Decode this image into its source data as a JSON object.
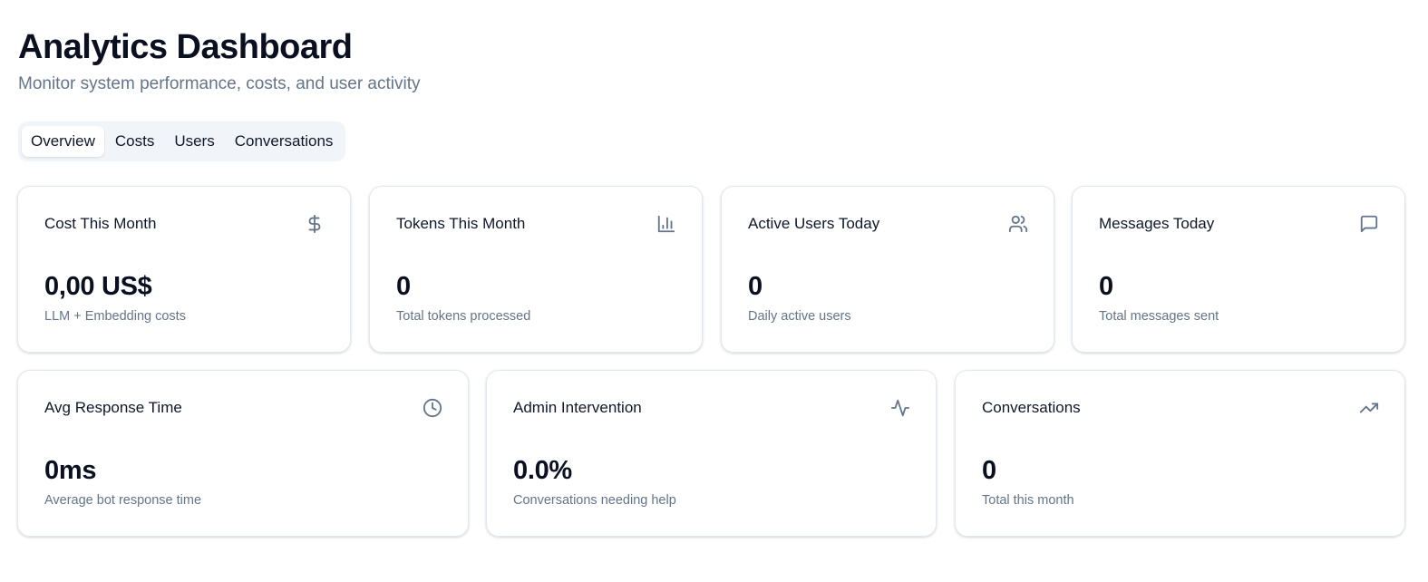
{
  "header": {
    "title": "Analytics Dashboard",
    "subtitle": "Monitor system performance, costs, and user activity"
  },
  "tabs": [
    {
      "label": "Overview",
      "active": true
    },
    {
      "label": "Costs",
      "active": false
    },
    {
      "label": "Users",
      "active": false
    },
    {
      "label": "Conversations",
      "active": false
    }
  ],
  "stats_row1": [
    {
      "label": "Cost This Month",
      "value": "0,00 US$",
      "description": "LLM + Embedding costs",
      "icon": "dollar-icon"
    },
    {
      "label": "Tokens This Month",
      "value": "0",
      "description": "Total tokens processed",
      "icon": "bar-chart-icon"
    },
    {
      "label": "Active Users Today",
      "value": "0",
      "description": "Daily active users",
      "icon": "users-icon"
    },
    {
      "label": "Messages Today",
      "value": "0",
      "description": "Total messages sent",
      "icon": "message-icon"
    }
  ],
  "stats_row2": [
    {
      "label": "Avg Response Time",
      "value": "0ms",
      "description": "Average bot response time",
      "icon": "clock-icon"
    },
    {
      "label": "Admin Intervention",
      "value": "0.0%",
      "description": "Conversations needing help",
      "icon": "activity-icon"
    },
    {
      "label": "Conversations",
      "value": "0",
      "description": "Total this month",
      "icon": "trending-up-icon"
    }
  ],
  "colors": {
    "text_primary": "#0f172a",
    "text_muted": "#64748b",
    "tab_background": "#f1f5f9",
    "card_border": "#e2e8f0"
  }
}
